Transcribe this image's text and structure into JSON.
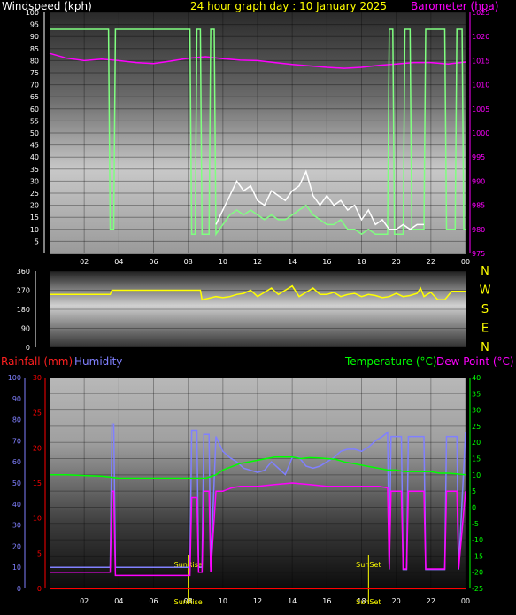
{
  "colors": {
    "background": "#000000",
    "windspeed": "#ffffff",
    "gust": "#80ff80",
    "barometer": "#ff00ff",
    "direction": "#ffff00",
    "rainfall": "#ff0000",
    "humidity": "#8080ff",
    "temperature": "#00ff00",
    "dewpoint": "#ff00ff",
    "solar": "#ffff00"
  },
  "chart_data": [
    {
      "type": "line",
      "title": "24 hour graph day : 10 January 2025",
      "left_label": "Windspeed (kph)",
      "right_label": "Barometer (hpa)",
      "x_ticks": [
        "02",
        "04",
        "06",
        "08",
        "10",
        "12",
        "14",
        "16",
        "18",
        "20",
        "22",
        "00"
      ],
      "y_left_ticks": [
        5,
        10,
        15,
        20,
        25,
        30,
        35,
        40,
        45,
        50,
        55,
        60,
        65,
        70,
        75,
        80,
        85,
        90,
        95,
        100
      ],
      "y_left_lim": [
        0,
        100
      ],
      "y_right_ticks": [
        975,
        980,
        985,
        990,
        995,
        1000,
        1005,
        1010,
        1015,
        1020,
        1025
      ],
      "y_right_lim": [
        975,
        1025
      ],
      "x_hours_lim": [
        0,
        24
      ],
      "grid": true,
      "series": [
        {
          "name": "Windspeed",
          "axis": "left",
          "x": [
            9.6,
            10.0,
            10.4,
            10.8,
            11.2,
            11.6,
            12.0,
            12.4,
            12.8,
            13.2,
            13.6,
            14.0,
            14.4,
            14.8,
            15.2,
            15.6,
            16.0,
            16.4,
            16.8,
            17.2,
            17.6,
            18.0,
            18.4,
            18.8,
            19.2,
            19.6,
            20.0,
            20.4,
            20.8,
            21.2,
            21.6
          ],
          "values": [
            12,
            18,
            24,
            30,
            26,
            28,
            22,
            20,
            26,
            24,
            22,
            26,
            28,
            34,
            24,
            20,
            24,
            20,
            22,
            18,
            20,
            14,
            18,
            12,
            14,
            10,
            10,
            12,
            10,
            12,
            12
          ]
        },
        {
          "name": "Gust",
          "axis": "left",
          "x": [
            0.0,
            3.4,
            3.5,
            3.7,
            3.8,
            8.1,
            8.2,
            8.4,
            8.5,
            8.7,
            8.8,
            9.2,
            9.3,
            9.5,
            9.6,
            10.0,
            10.4,
            10.8,
            11.2,
            11.6,
            12.0,
            12.4,
            12.8,
            13.2,
            13.6,
            14.0,
            14.4,
            14.8,
            15.2,
            15.6,
            16.0,
            16.4,
            16.8,
            17.2,
            17.6,
            18.0,
            18.4,
            18.8,
            19.2,
            19.5,
            19.6,
            19.8,
            19.9,
            20.4,
            20.5,
            20.8,
            20.9,
            21.6,
            21.7,
            22.8,
            22.9,
            23.4,
            23.5,
            23.8,
            23.9,
            24.0
          ],
          "values": [
            93,
            93,
            10,
            10,
            93,
            93,
            8,
            8,
            93,
            93,
            8,
            8,
            93,
            93,
            8,
            12,
            16,
            18,
            16,
            18,
            16,
            14,
            16,
            14,
            14,
            16,
            18,
            20,
            16,
            14,
            12,
            12,
            14,
            10,
            10,
            8,
            10,
            8,
            8,
            8,
            93,
            93,
            8,
            8,
            93,
            93,
            10,
            10,
            93,
            93,
            10,
            10,
            93,
            93,
            10,
            10
          ]
        },
        {
          "name": "Barometer",
          "axis": "right",
          "x": [
            0,
            1,
            2,
            3,
            4,
            5,
            6,
            7,
            8,
            9,
            10,
            11,
            12,
            13,
            14,
            15,
            16,
            17,
            18,
            19,
            20,
            21,
            22,
            23,
            24
          ],
          "values": [
            1016.5,
            1015.5,
            1015.0,
            1015.3,
            1015.0,
            1014.6,
            1014.4,
            1014.9,
            1015.5,
            1015.8,
            1015.4,
            1015.1,
            1015.0,
            1014.6,
            1014.2,
            1013.9,
            1013.6,
            1013.4,
            1013.6,
            1014.0,
            1014.3,
            1014.6,
            1014.6,
            1014.3,
            1014.7
          ]
        }
      ]
    },
    {
      "type": "line",
      "y_ticks": [
        0,
        90,
        180,
        270,
        360
      ],
      "y_lim": [
        0,
        360
      ],
      "compass": [
        "N",
        "W",
        "S",
        "E",
        "N"
      ],
      "x_hours_lim": [
        0,
        24
      ],
      "series": [
        {
          "name": "Wind direction",
          "x": [
            0,
            3.5,
            3.6,
            8.7,
            8.8,
            9.6,
            10.0,
            10.4,
            10.8,
            11.2,
            11.6,
            12.0,
            12.4,
            12.8,
            13.2,
            13.6,
            14.0,
            14.4,
            14.8,
            15.2,
            15.6,
            16.0,
            16.4,
            16.8,
            17.2,
            17.6,
            18.0,
            18.4,
            18.8,
            19.2,
            19.6,
            20.0,
            20.4,
            20.8,
            21.2,
            21.4,
            21.6,
            22.0,
            22.4,
            22.8,
            23.2,
            24.0
          ],
          "values": [
            250,
            250,
            270,
            270,
            225,
            240,
            235,
            240,
            250,
            255,
            270,
            240,
            260,
            280,
            250,
            270,
            290,
            240,
            260,
            280,
            250,
            250,
            260,
            240,
            250,
            255,
            240,
            250,
            245,
            235,
            240,
            255,
            240,
            245,
            255,
            280,
            240,
            260,
            225,
            225,
            265,
            265
          ]
        }
      ]
    },
    {
      "type": "line",
      "left_label_1": "Rainfall (mm)",
      "left_label_2": "Humidity",
      "right_label_1": "Temperature (°C)",
      "right_label_2": "Dew Point (°C)",
      "x_ticks": [
        "02",
        "04",
        "06",
        "08",
        "10",
        "12",
        "14",
        "16",
        "18",
        "20",
        "22",
        "00"
      ],
      "humidity_ticks": [
        0,
        10,
        20,
        30,
        40,
        50,
        60,
        70,
        80,
        90,
        100
      ],
      "humidity_lim": [
        0,
        100
      ],
      "rain_ticks": [
        0,
        5,
        10,
        15,
        20,
        25,
        30
      ],
      "rain_lim": [
        0,
        30
      ],
      "temp_ticks": [
        -25,
        -20,
        -15,
        -10,
        -5,
        0,
        5,
        10,
        15,
        20,
        25,
        30,
        35,
        40
      ],
      "temp_lim": [
        -25,
        40
      ],
      "x_hours_lim": [
        0,
        24
      ],
      "sun_events": [
        {
          "label": "SunRise",
          "x": 8.0
        },
        {
          "label": "SunSet",
          "x": 18.4
        }
      ],
      "series": [
        {
          "name": "Humidity",
          "axis": "humidity",
          "x": [
            0,
            3.5,
            3.6,
            3.7,
            3.8,
            8.1,
            8.2,
            8.5,
            8.6,
            8.8,
            8.9,
            9.2,
            9.3,
            9.6,
            10.0,
            10.4,
            10.8,
            11.2,
            11.6,
            12.0,
            12.4,
            12.8,
            13.2,
            13.6,
            14.0,
            14.4,
            14.8,
            15.2,
            15.6,
            16.0,
            16.4,
            16.8,
            17.2,
            17.6,
            18.0,
            18.4,
            18.8,
            19.2,
            19.5,
            19.6,
            19.7,
            20.3,
            20.4,
            20.6,
            20.7,
            21.6,
            21.7,
            22.8,
            22.9,
            23.5,
            23.6,
            24.0
          ],
          "values": [
            10,
            10,
            78,
            78,
            10,
            10,
            75,
            75,
            10,
            10,
            73,
            73,
            10,
            72,
            65,
            62,
            60,
            57,
            56,
            55,
            56,
            60,
            57,
            54,
            62,
            62,
            58,
            57,
            58,
            60,
            62,
            65,
            66,
            66,
            65,
            67,
            70,
            72,
            74,
            9,
            72,
            72,
            9,
            9,
            72,
            72,
            9,
            9,
            72,
            72,
            9,
            74
          ]
        },
        {
          "name": "Temperature",
          "axis": "temp",
          "x": [
            0,
            1,
            2,
            3,
            4,
            5,
            6,
            7,
            8,
            9,
            9.6,
            10,
            10.5,
            11,
            11.5,
            12,
            12.5,
            13,
            13.5,
            14,
            14.5,
            15,
            15.5,
            16,
            16.5,
            17,
            17.5,
            18,
            18.5,
            19,
            19.5,
            20,
            20.5,
            21,
            21.5,
            22,
            22.5,
            23,
            24
          ],
          "values": [
            10.0,
            10.0,
            9.8,
            9.6,
            9.0,
            9.0,
            9.0,
            9.0,
            9.0,
            9.0,
            10.0,
            11.5,
            12.5,
            13.5,
            14.0,
            14.5,
            15.0,
            15.5,
            15.5,
            15.5,
            15.0,
            15.3,
            15.2,
            15.0,
            14.8,
            14.0,
            13.5,
            13.0,
            12.5,
            12.0,
            11.5,
            11.5,
            11.0,
            11.0,
            11.0,
            11.0,
            10.5,
            10.5,
            10.0
          ]
        },
        {
          "name": "Dew Point",
          "axis": "temp",
          "x": [
            0,
            3.5,
            3.6,
            3.7,
            3.8,
            8.1,
            8.2,
            8.5,
            8.6,
            8.8,
            8.9,
            9.2,
            9.3,
            9.6,
            10,
            10.5,
            11,
            12,
            13,
            14,
            15,
            16,
            17,
            18,
            19,
            19.5,
            19.6,
            19.7,
            20.3,
            20.4,
            20.6,
            20.7,
            21.6,
            21.7,
            22.8,
            22.9,
            23.5,
            23.6,
            24
          ],
          "values": [
            -20,
            -20,
            5,
            5,
            -21,
            -21,
            3,
            3,
            -20,
            -20,
            5,
            5,
            -20,
            5,
            5,
            6,
            6.5,
            6.5,
            7,
            7.5,
            7,
            6.5,
            6.5,
            6.5,
            6.5,
            6,
            -19,
            5,
            5,
            -19,
            -19,
            5,
            5,
            -19,
            -19,
            5,
            5,
            -19,
            5
          ]
        },
        {
          "name": "Rainfall",
          "axis": "rain",
          "x": [
            0,
            24
          ],
          "values": [
            0,
            0
          ]
        }
      ]
    }
  ]
}
